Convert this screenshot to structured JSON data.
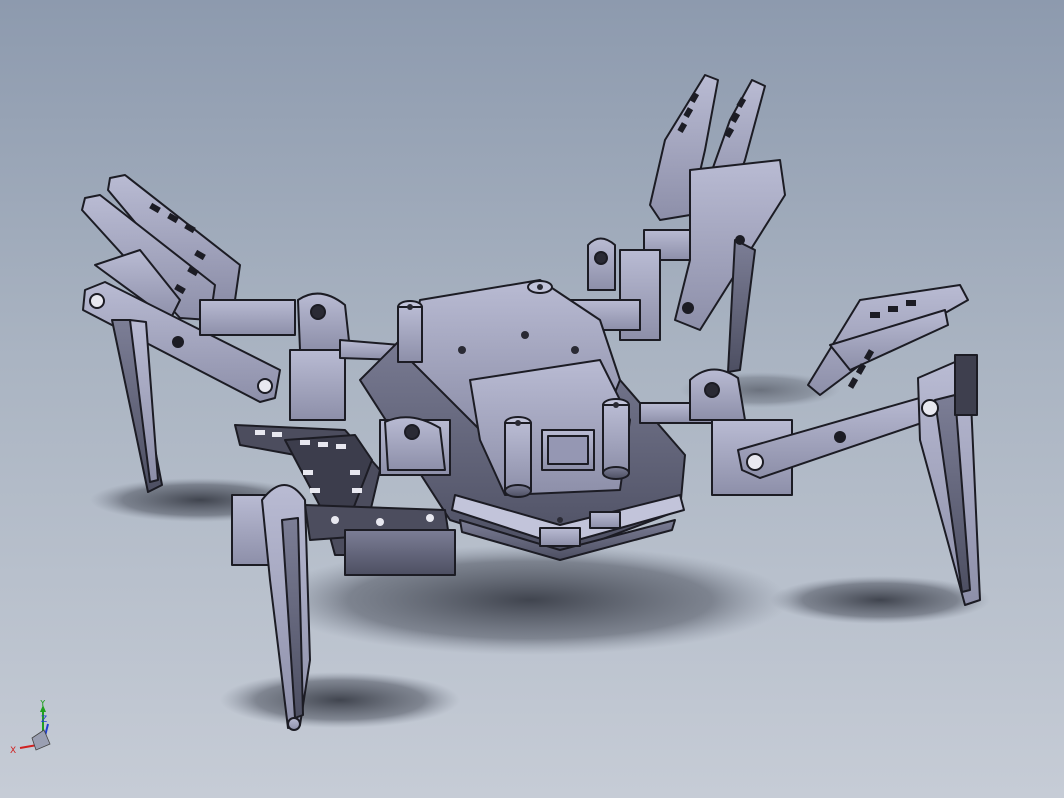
{
  "view": {
    "background_top": "#8d9aae",
    "background_bottom": "#c6ccd6",
    "model_fill": "#a7a9c2",
    "model_stroke": "#1c1c24"
  },
  "triad": {
    "x_label": "X",
    "y_label": "Y",
    "z_label": "Z",
    "x_color": "#d02020",
    "y_color": "#20a020",
    "z_color": "#2040d0"
  }
}
